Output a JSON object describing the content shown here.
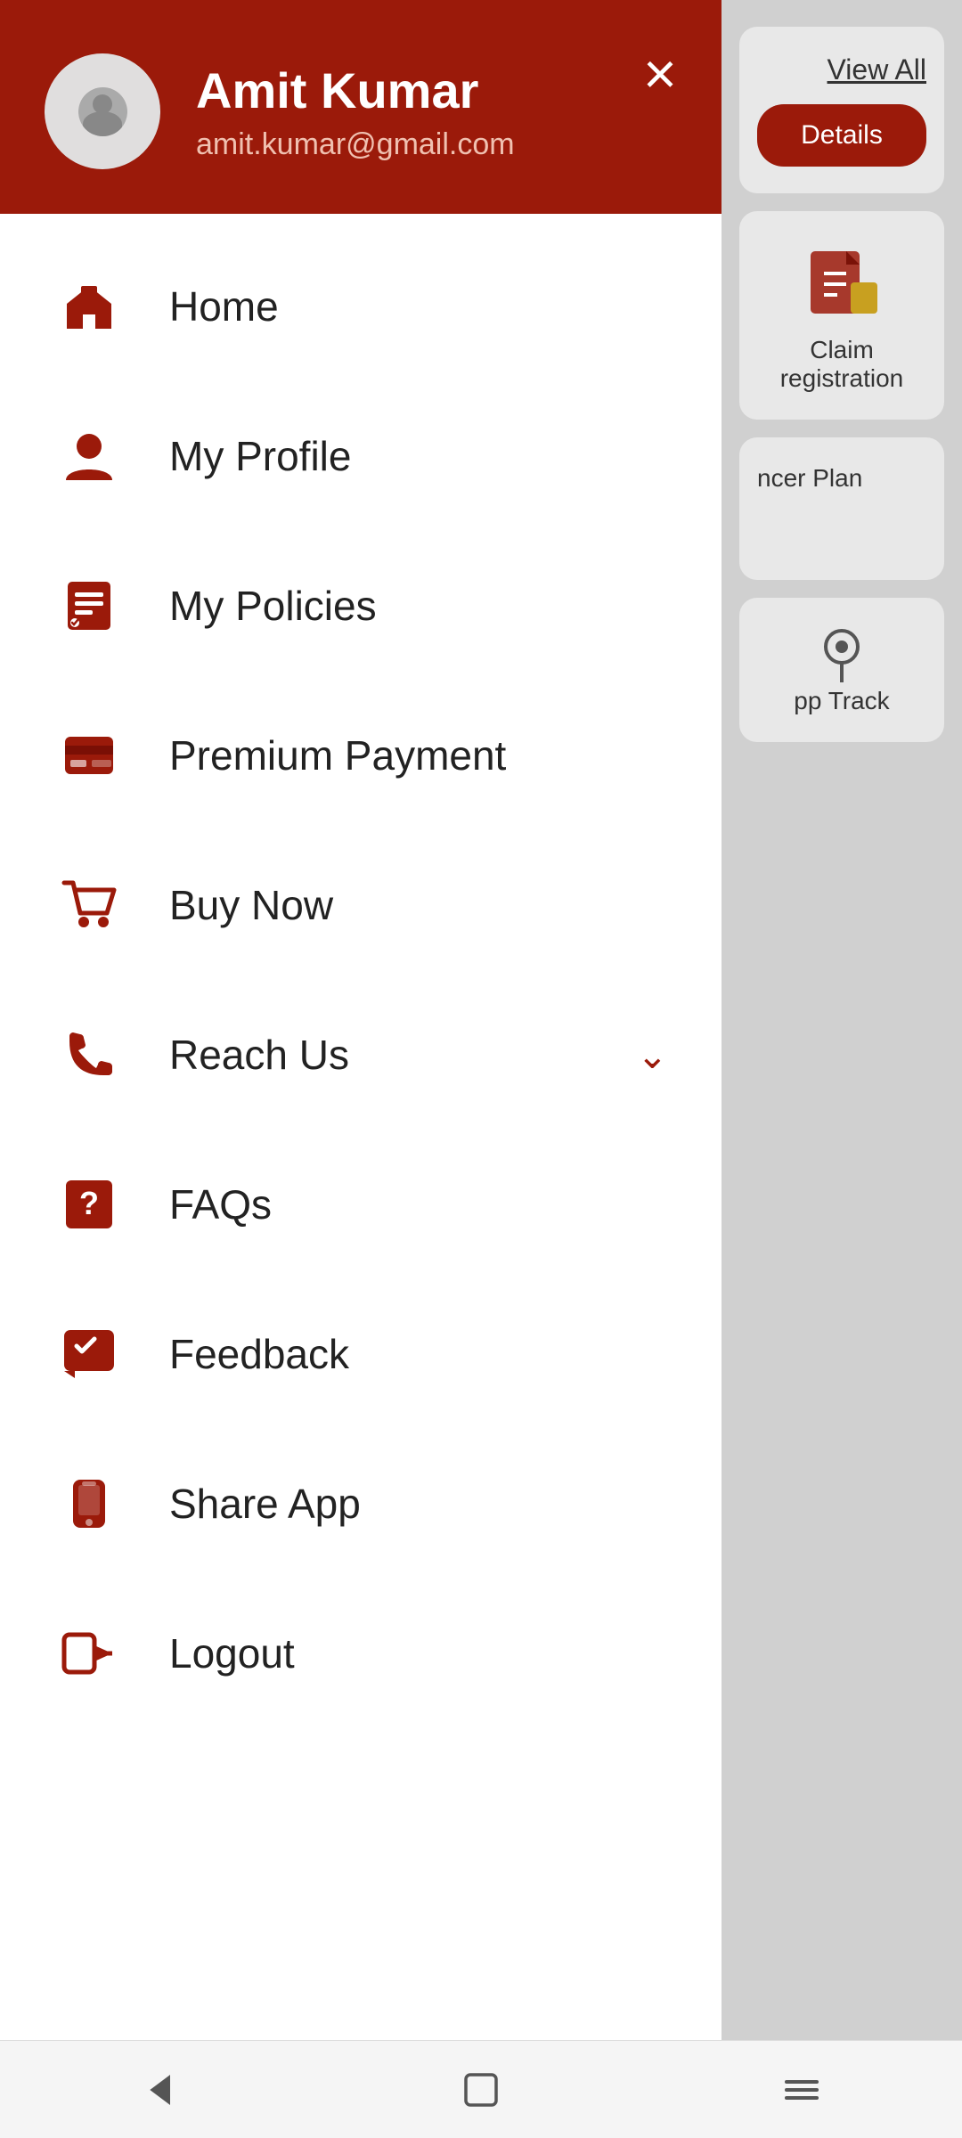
{
  "header": {
    "user_name": "Amit Kumar",
    "user_email": "amit.kumar@gmail.com",
    "close_label": "×"
  },
  "menu": {
    "items": [
      {
        "id": "home",
        "label": "Home",
        "icon": "home-icon",
        "has_chevron": false
      },
      {
        "id": "my-profile",
        "label": "My Profile",
        "icon": "profile-icon",
        "has_chevron": false
      },
      {
        "id": "my-policies",
        "label": "My Policies",
        "icon": "policies-icon",
        "has_chevron": false
      },
      {
        "id": "premium-payment",
        "label": "Premium Payment",
        "icon": "payment-icon",
        "has_chevron": false
      },
      {
        "id": "buy-now",
        "label": "Buy Now",
        "icon": "cart-icon",
        "has_chevron": false
      },
      {
        "id": "reach-us",
        "label": "Reach Us",
        "icon": "phone-icon",
        "has_chevron": true
      },
      {
        "id": "faqs",
        "label": "FAQs",
        "icon": "faq-icon",
        "has_chevron": false
      },
      {
        "id": "feedback",
        "label": "Feedback",
        "icon": "feedback-icon",
        "has_chevron": false
      },
      {
        "id": "share-app",
        "label": "Share App",
        "icon": "share-icon",
        "has_chevron": false
      },
      {
        "id": "logout",
        "label": "Logout",
        "icon": "logout-icon",
        "has_chevron": false
      }
    ]
  },
  "background": {
    "view_all": "View All",
    "btn_details": "Details",
    "claim_label": "Claim\nregistration",
    "cancer_plan": "ncer Plan",
    "app_track": "pp Track"
  },
  "nav": {
    "back": "◁",
    "home": "□",
    "menu": "≡"
  }
}
